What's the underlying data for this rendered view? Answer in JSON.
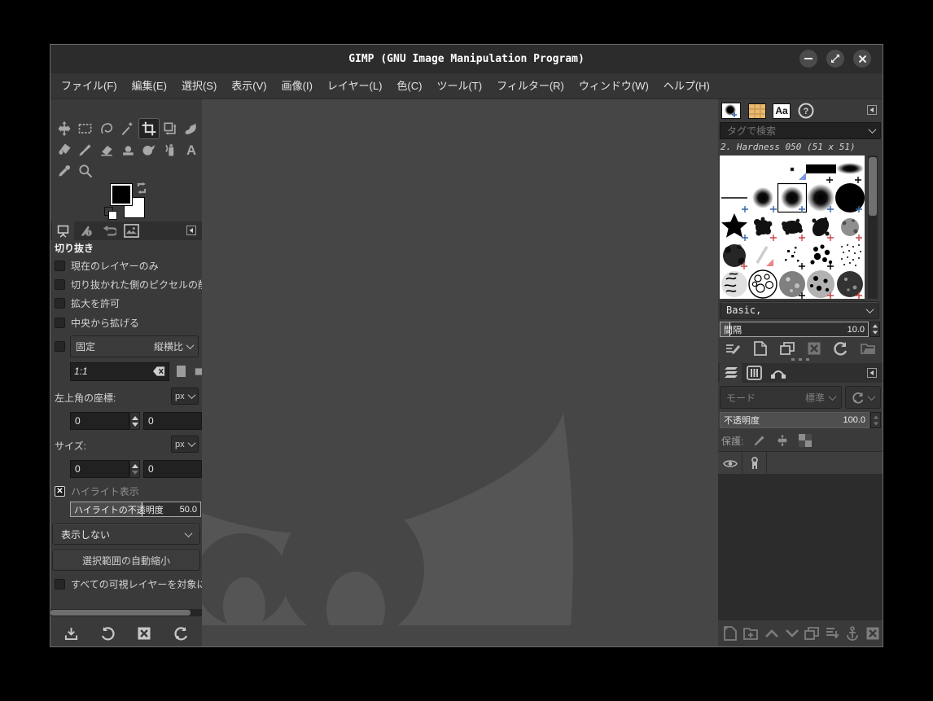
{
  "window": {
    "title": "GIMP (GNU Image Manipulation Program)"
  },
  "menu": {
    "items": [
      {
        "label": "ファイル(F)"
      },
      {
        "label": "編集(E)"
      },
      {
        "label": "選択(S)"
      },
      {
        "label": "表示(V)"
      },
      {
        "label": "画像(I)"
      },
      {
        "label": "レイヤー(L)"
      },
      {
        "label": "色(C)"
      },
      {
        "label": "ツール(T)"
      },
      {
        "label": "フィルター(R)"
      },
      {
        "label": "ウィンドウ(W)"
      },
      {
        "label": "ヘルプ(H)"
      }
    ]
  },
  "toolbox": {
    "tools": [
      "move",
      "rectangle-select",
      "free-select",
      "fuzzy-select",
      "crop",
      "unified-transform",
      "warp-transform",
      "bucket-fill",
      "paintbrush",
      "eraser",
      "clone",
      "smudge",
      "airbrush",
      "text",
      "color-picker",
      "zoom"
    ],
    "active_tool": "crop",
    "foreground_color": "#000000",
    "background_color": "#ffffff"
  },
  "left_dock": {
    "tabs": [
      "tool-options",
      "device-status",
      "undo-history",
      "images"
    ],
    "bottom_actions": [
      "save-tool-preset",
      "restore-tool-preset",
      "delete-tool-preset",
      "reset-tool-options"
    ]
  },
  "tool_options": {
    "title": "切り抜き",
    "checkboxes": [
      {
        "label": "現在のレイヤーのみ",
        "checked": false
      },
      {
        "label": "切り抜かれた側のピクセルの削除",
        "checked": false
      },
      {
        "label": "拡大を許可",
        "checked": false
      },
      {
        "label": "中央から拡げる",
        "checked": false
      }
    ],
    "fixed": {
      "label": "固定",
      "checked": false,
      "mode": "縦横比"
    },
    "ratio_value": "1:1",
    "position": {
      "label": "左上角の座標:",
      "unit": "px",
      "x": "0",
      "y": "0"
    },
    "size": {
      "label": "サイズ:",
      "unit": "px",
      "w": "0",
      "h": "0"
    },
    "highlight": {
      "label": "ハイライト表示",
      "checked": true
    },
    "highlight_opacity": {
      "label": "ハイライトの不透明度",
      "value": "50.0",
      "percent": 50
    },
    "guides": "表示しない",
    "autoshrink_button": "選択範囲の自動縮小",
    "shrink_merged": {
      "label": "すべての可視レイヤーを対象にする",
      "checked": false
    }
  },
  "brushes": {
    "tabs": [
      "brushes",
      "patterns",
      "fonts",
      "document-history"
    ],
    "search_placeholder": "タグで検索",
    "selected_brush": "2. Hardness 050 (51 x 51)",
    "tag_filter": "Basic,",
    "spacing": {
      "label": "間隔",
      "value": "10.0"
    },
    "actions": [
      "edit-brush",
      "new-brush",
      "duplicate-brush",
      "delete-brush",
      "refresh-brushes",
      "open-brush-as-image"
    ],
    "fonts_tab_glyph": "Aa"
  },
  "layers": {
    "tabs": [
      "layers",
      "channels",
      "paths"
    ],
    "mode": {
      "label": "モード",
      "value": "標準"
    },
    "opacity": {
      "label": "不透明度",
      "value": "100.0",
      "percent": 100
    },
    "lock": {
      "label": "保護:",
      "buttons": [
        "lock-pixels",
        "lock-position",
        "lock-alpha"
      ]
    },
    "bottom_actions": [
      "new-layer",
      "new-layer-group",
      "raise-layer",
      "lower-layer",
      "duplicate-layer",
      "merge-down",
      "anchor-layer",
      "delete-layer"
    ]
  },
  "colors": {
    "canvas": "#464646",
    "watermark": "#555555",
    "dock": "#3a3a3a",
    "titlebar": "#2c2c2c",
    "pattern_tab_accent": "#e9b96e"
  }
}
